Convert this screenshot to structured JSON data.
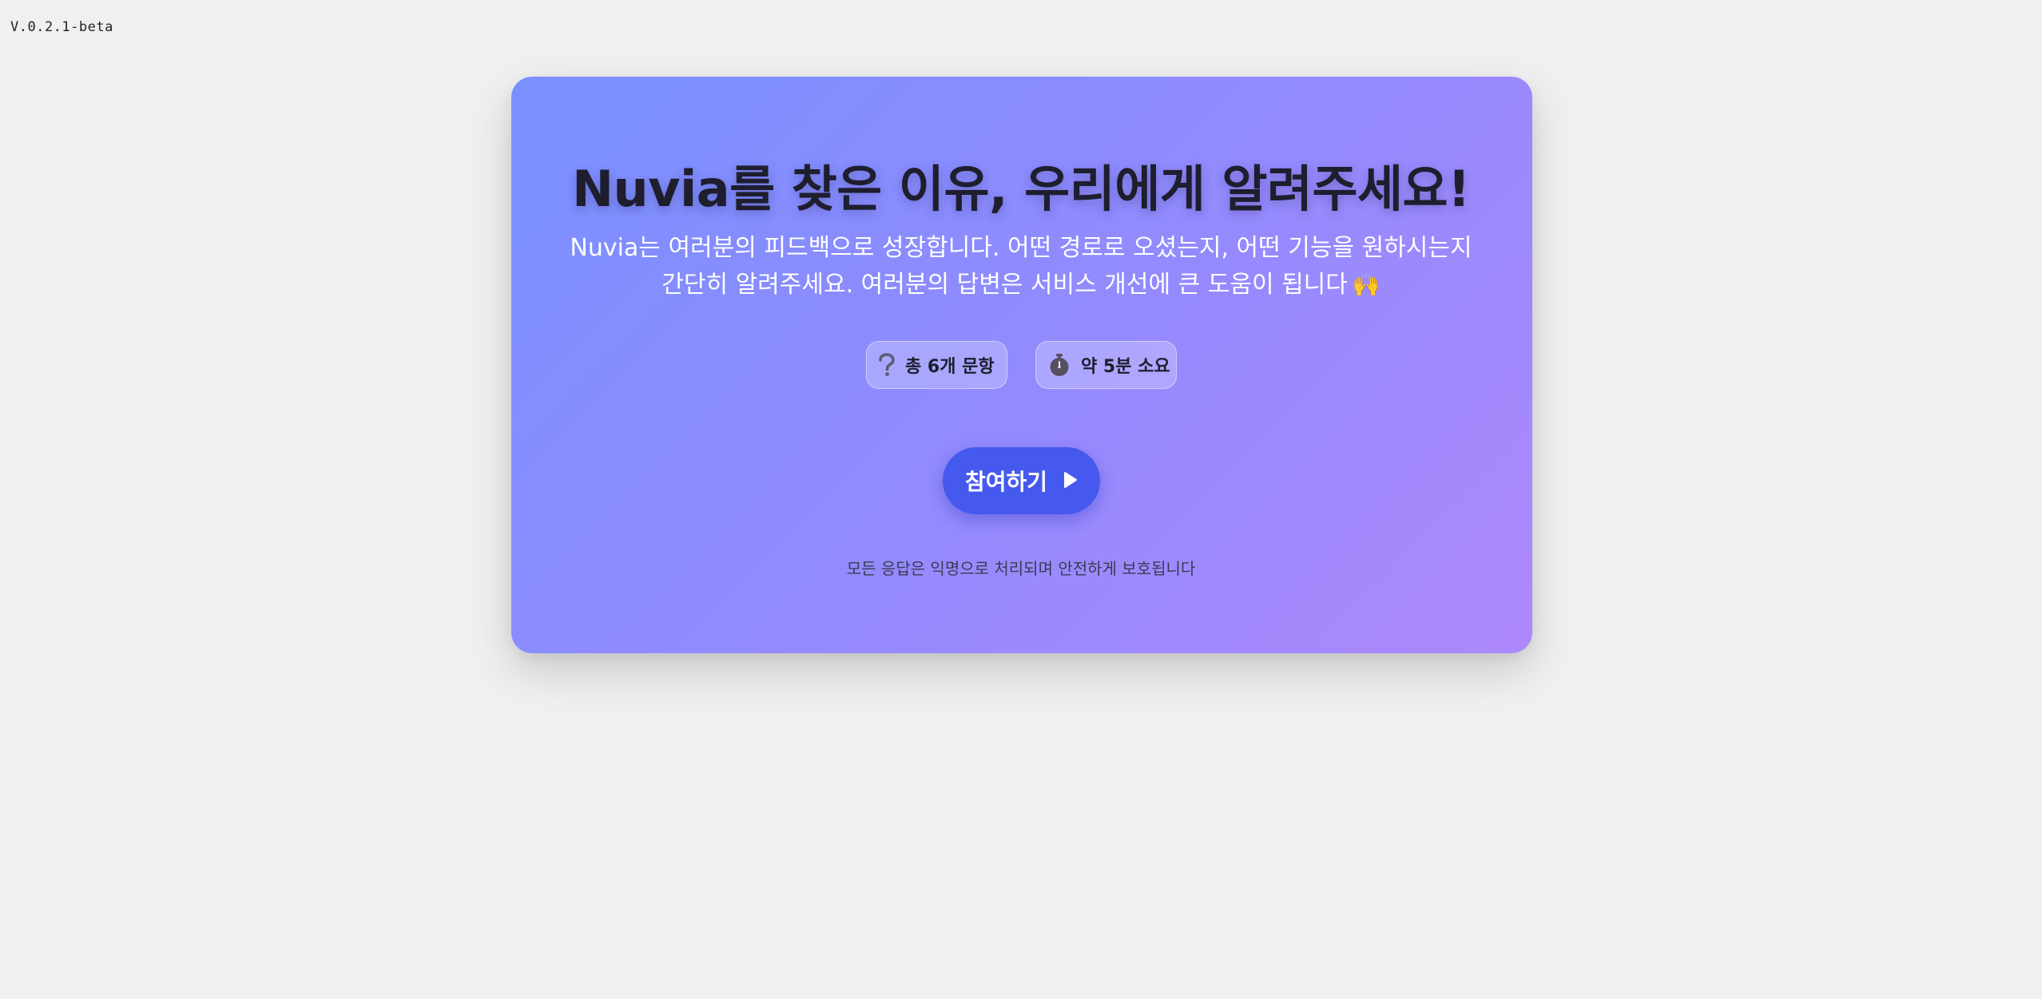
{
  "app": {
    "version": "V.0.2.1-beta"
  },
  "hero": {
    "title": "Nuvia를 찾은 이유, 우리에게 알려주세요!",
    "subtitle_line1": "Nuvia는 여러분의 피드백으로 성장합니다. 어떤 경로로 오셨는지, 어떤 기능을 원하시는지",
    "subtitle_line2": "간단히 알려주세요. 여러분의 답변은 서비스 개선에 큰 도움이 됩니다",
    "subtitle_emoji": "🙌",
    "subtitle_emoji_icon": "raising-hands-icon"
  },
  "chips": [
    {
      "icon": "question-mark-icon",
      "label": "총 6개 문항"
    },
    {
      "icon": "stopwatch-icon",
      "label": "약 5분 소요"
    }
  ],
  "cta": {
    "label": "참여하기",
    "icon": "play-icon"
  },
  "footer_note": "모든 응답은 익명으로 처리되며 안전하게 보호됩니다",
  "colors": {
    "background": "#f0f0f0",
    "card_gradient_start": "#7990ff",
    "card_gradient_end": "#ad88fc",
    "cta": "#4559ef",
    "title": "#1e1e2e"
  }
}
